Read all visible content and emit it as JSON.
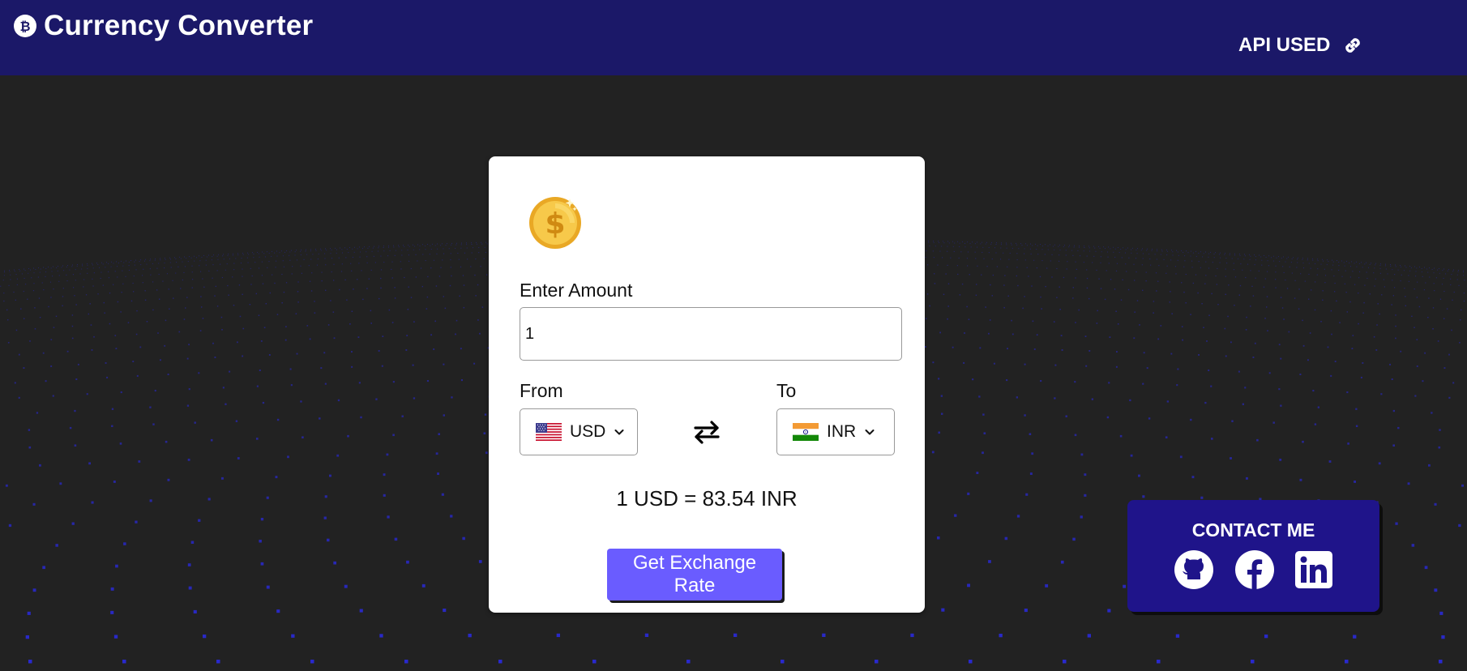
{
  "navbar": {
    "brand_icon": "bitcoin-icon",
    "title": "Currency Converter",
    "api_label": "API USED",
    "api_icon": "link-icon",
    "background": "#1b1868"
  },
  "converter": {
    "icon": "dollar-coin-icon",
    "amount_label": "Enter Amount",
    "amount_value": "1",
    "from_label": "From",
    "from_currency": "USD",
    "from_flag": "us-flag-icon",
    "to_label": "To",
    "to_currency": "INR",
    "to_flag": "india-flag-icon",
    "swap_icon": "swap-arrows-icon",
    "result_text": "1 USD = 83.54 INR",
    "button_label": "Get Exchange Rate",
    "button_color": "#6a5cff"
  },
  "contact": {
    "title": "CONTACT ME",
    "links": [
      {
        "icon": "github-icon"
      },
      {
        "icon": "facebook-icon"
      },
      {
        "icon": "linkedin-icon"
      }
    ],
    "background": "#1f148a"
  },
  "background": {
    "color": "#222222",
    "dot_color": "#2a2ad8"
  }
}
